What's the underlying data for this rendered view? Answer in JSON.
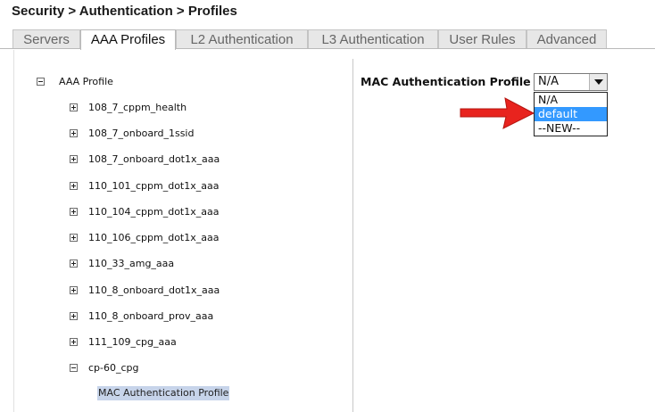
{
  "breadcrumb": "Security > Authentication > Profiles",
  "tabs": [
    "Servers",
    "AAA Profiles",
    "L2 Authentication",
    "L3 Authentication",
    "User Rules",
    "Advanced"
  ],
  "active_tab": "AAA Profiles",
  "tree": {
    "root_label": "AAA Profile",
    "items": [
      "108_7_cppm_health",
      "108_7_onboard_1ssid",
      "108_7_onboard_dot1x_aaa",
      "110_101_cppm_dot1x_aaa",
      "110_104_cppm_dot1x_aaa",
      "110_106_cppm_dot1x_aaa",
      "110_33_amg_aaa",
      "110_8_onboard_dot1x_aaa",
      "110_8_onboard_prov_aaa",
      "111_109_cpg_aaa",
      "cp-60_cpg"
    ],
    "child_label": "MAC Authentication Profile"
  },
  "detail": {
    "field_label": "MAC Authentication Profile >",
    "selected_value": "N/A",
    "options": [
      "N/A",
      "default",
      "--NEW--"
    ],
    "highlighted_option": "default"
  },
  "colors": {
    "arrow": "#e8231e",
    "highlight": "#3399ff",
    "selected_node": "#c7d4ea"
  }
}
